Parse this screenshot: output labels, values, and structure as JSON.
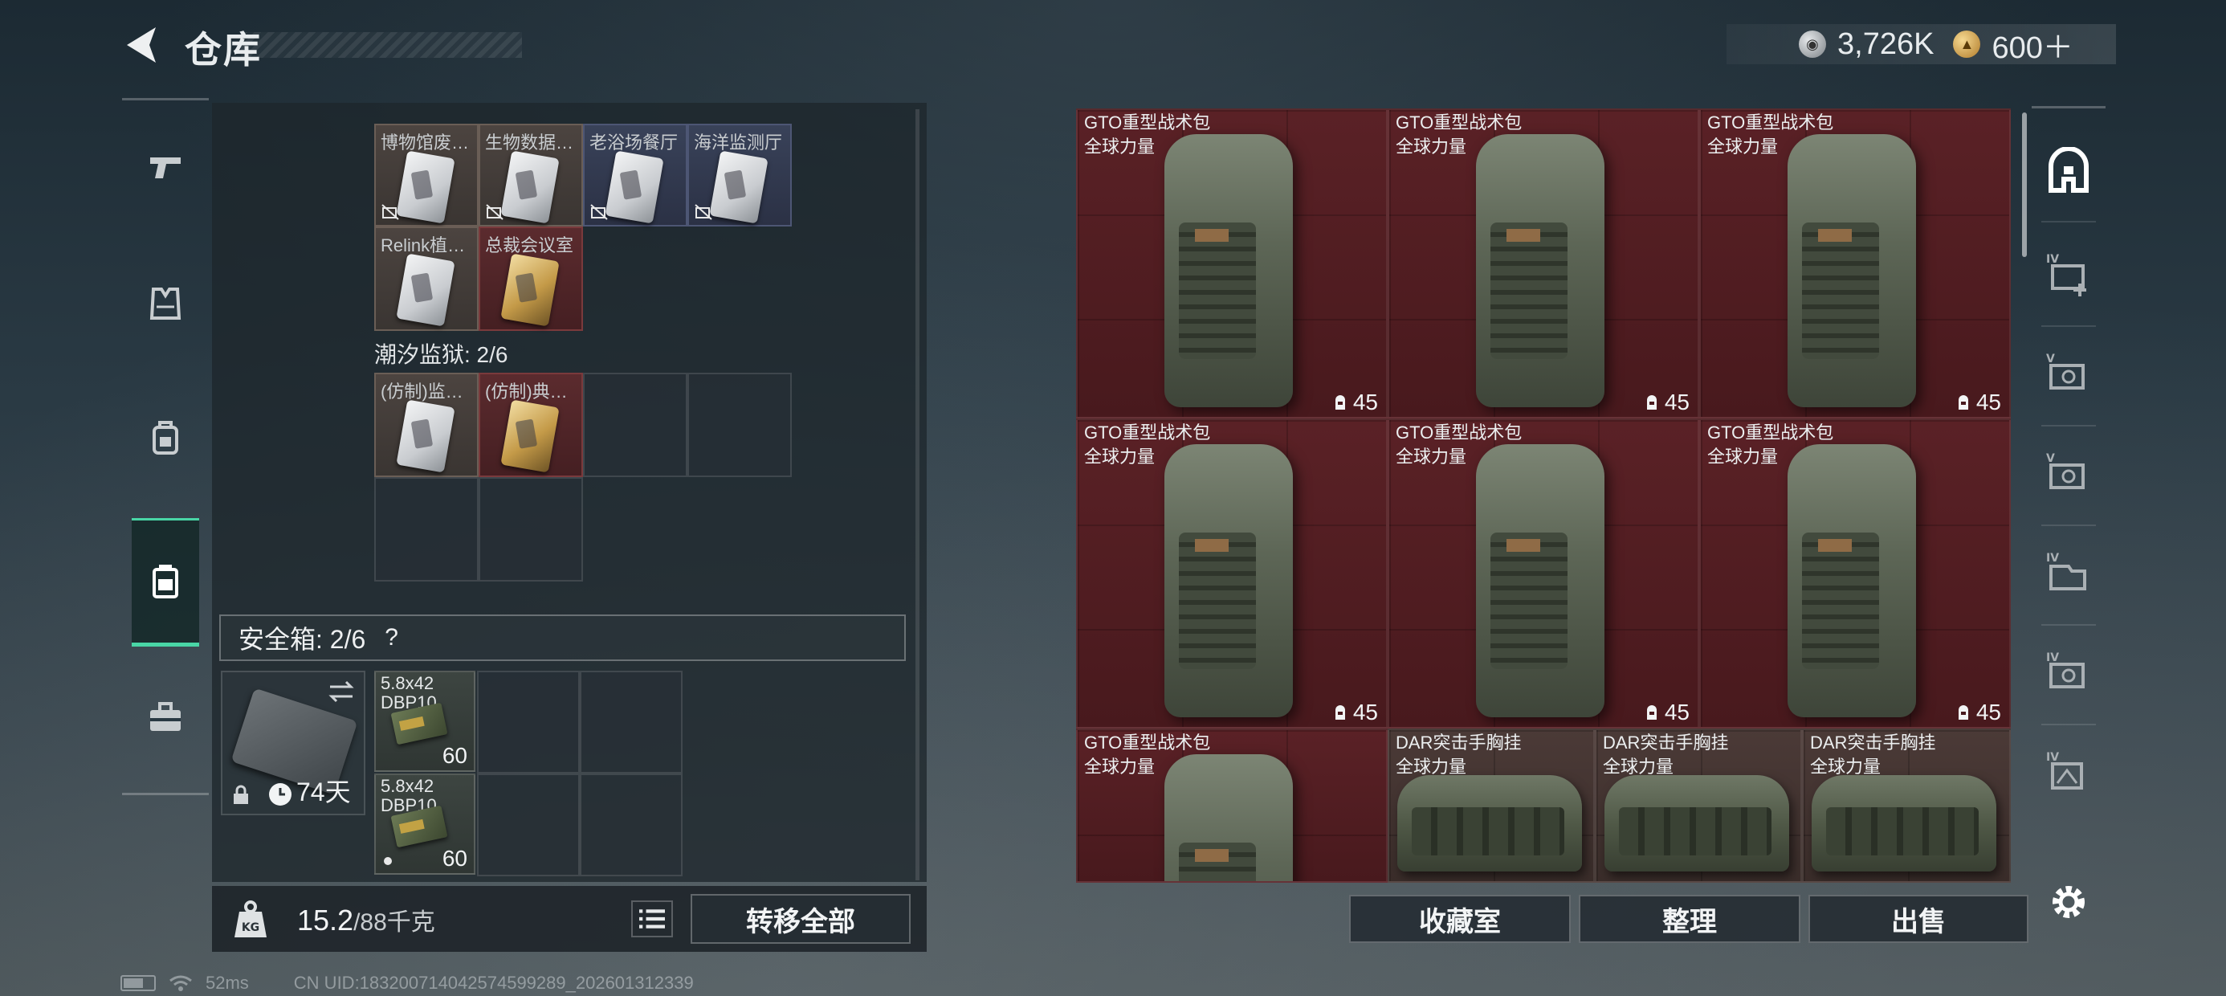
{
  "header": {
    "title": "仓库",
    "currency": [
      {
        "icon": "silver-coin-icon",
        "value": "3,726K"
      },
      {
        "icon": "gold-coin-icon",
        "value": "600＋"
      }
    ]
  },
  "left_nav": [
    "weapons-icon",
    "armor-icon",
    "backpack-icon",
    "storage-icon",
    "toolbox-icon"
  ],
  "inventory": {
    "row1": [
      "博物馆废…",
      "生物数据…",
      "老浴场餐厅",
      "海洋监测厅"
    ],
    "row2": [
      "Relink植…",
      "总裁会议室"
    ],
    "section_title": "潮汐监狱: 2/6",
    "row3": [
      "(仿制)监…",
      "(仿制)典…"
    ],
    "safe_box": {
      "title": "安全箱: 2/6",
      "help": "?",
      "days": "74天",
      "ammo": [
        {
          "name": "5.8x42 DBP10",
          "count": "60"
        },
        {
          "name": "5.8x42 DBP10",
          "count": "60"
        }
      ]
    }
  },
  "weight": {
    "current": "15.2",
    "max": "/88千克"
  },
  "buttons": {
    "transfer_all": "转移全部",
    "collection": "收藏室",
    "organize": "整理",
    "sell": "出售"
  },
  "stash_items": [
    {
      "name": "GTO重型战术包",
      "sub": "全球力量",
      "durability": "45"
    },
    {
      "name": "GTO重型战术包",
      "sub": "全球力量",
      "durability": "45"
    },
    {
      "name": "GTO重型战术包",
      "sub": "全球力量",
      "durability": "45"
    },
    {
      "name": "GTO重型战术包",
      "sub": "全球力量",
      "durability": "45"
    },
    {
      "name": "GTO重型战术包",
      "sub": "全球力量",
      "durability": "45"
    },
    {
      "name": "GTO重型战术包",
      "sub": "全球力量",
      "durability": "45"
    },
    {
      "name": "GTO重型战术包",
      "sub": "全球力量"
    },
    {
      "name": "DAR突击手胸挂",
      "sub": "全球力量"
    },
    {
      "name": "DAR突击手胸挂",
      "sub": "全球力量"
    },
    {
      "name": "DAR突击手胸挂",
      "sub": "全球力量"
    }
  ],
  "right_bar": [
    "stash-home-icon",
    "add-stash-iv-icon",
    "stash-v-1-icon",
    "stash-v-2-icon",
    "stash-iv-1-icon",
    "stash-iv-2-icon",
    "stash-iv-3-icon",
    "settings-icon"
  ],
  "status": {
    "ping": "52ms",
    "uid": "CN UID:183200714042574599289_202601312339"
  }
}
